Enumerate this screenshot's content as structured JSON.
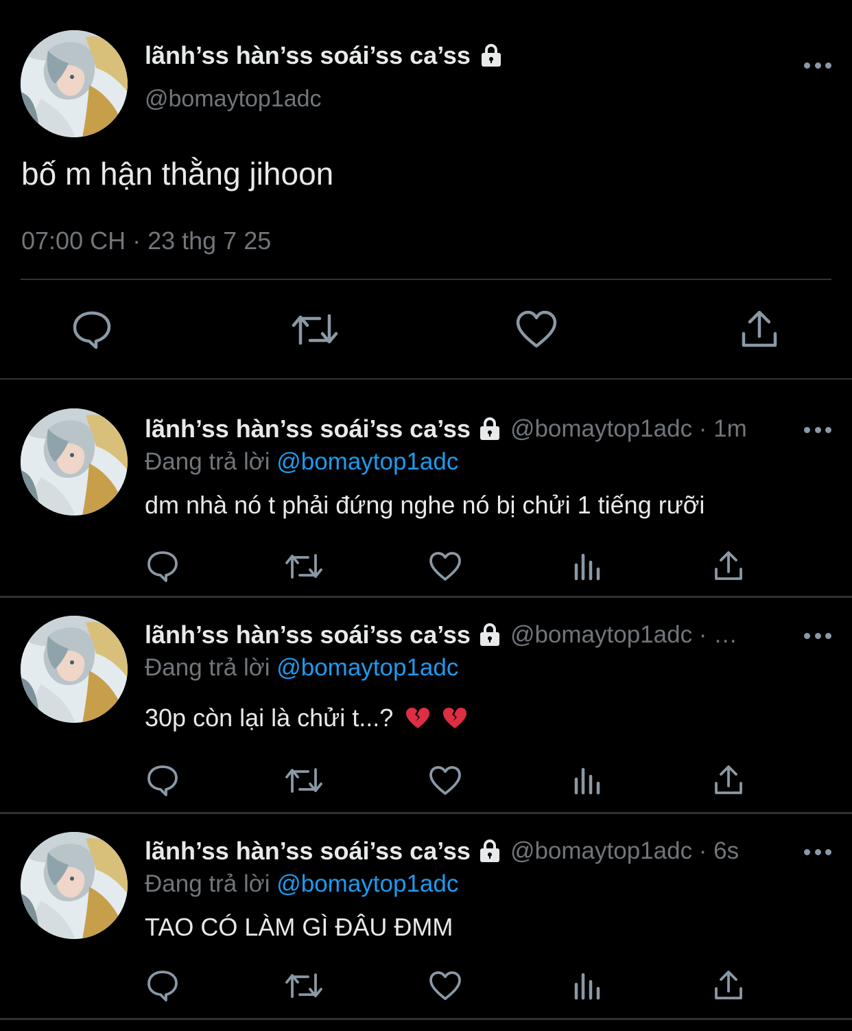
{
  "main_tweet": {
    "name": "lãnh’ss hàn’ss soái’ss ca’ss",
    "handle": "@bomaytop1adc",
    "text": "bố m hận thằng jihoon",
    "timestamp": "07:00 CH · 23 thg 7 25",
    "icons": [
      "lock-icon",
      "more-icon",
      "reply-icon",
      "retweet-icon",
      "like-icon",
      "share-icon"
    ]
  },
  "replies": [
    {
      "name": "lãnh’ss hàn’ss soái’ss ca’ss",
      "handle_meta": "@bomaytop1adc · 1m",
      "replying_prefix": "Đang trả lời",
      "replying_to": "@bomaytop1adc",
      "text": "dm nhà nó t phải đứng nghe nó bị chửi 1 tiếng rưỡi"
    },
    {
      "name": "lãnh’ss hàn’ss soái’ss ca’ss",
      "handle_meta": "@bomaytop1adc · …",
      "replying_prefix": "Đang trả lời",
      "replying_to": "@bomaytop1adc",
      "text": "30p còn lại là chửi t...?",
      "emojis": [
        "broken-heart",
        "broken-heart"
      ]
    },
    {
      "name": "lãnh’ss hàn’ss soái’ss ca’ss",
      "handle_meta": "@bomaytop1adc · 6s",
      "replying_prefix": "Đang trả lời",
      "replying_to": "@bomaytop1adc",
      "text": "TAO CÓ LÀM GÌ ĐÂU ĐMM"
    }
  ],
  "colors": {
    "background": "#000000",
    "text": "#e7e9ea",
    "secondary": "#71767b",
    "link": "#1d9bf0",
    "divider": "#2f3336"
  }
}
